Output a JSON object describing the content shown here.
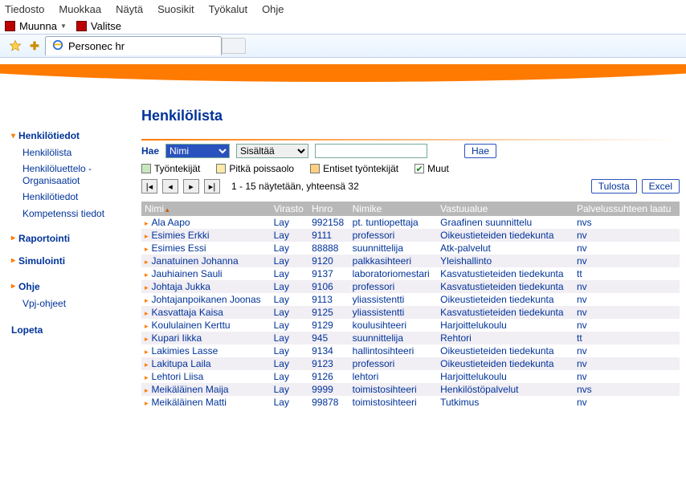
{
  "menubar": [
    "Tiedosto",
    "Muokkaa",
    "Näytä",
    "Suosikit",
    "Työkalut",
    "Ohje"
  ],
  "toolbar": {
    "convert": "Muunna",
    "select": "Valitse"
  },
  "tab_title": "Personec hr",
  "sidebar": {
    "sections": [
      {
        "label": "Henkilötiedot",
        "items": [
          "Henkilölista",
          "Henkilöluettelo - Organisaatiot",
          "Henkilötiedot",
          "Kompetenssi tiedot"
        ]
      },
      {
        "label": "Raportointi",
        "items": []
      },
      {
        "label": "Simulointi",
        "items": []
      },
      {
        "label": "Ohje",
        "items": [
          "Vpj-ohjeet"
        ]
      },
      {
        "label": "Lopeta",
        "items": []
      }
    ]
  },
  "page_title": "Henkilölista",
  "filters": {
    "label": "Hae",
    "field": "Nimi",
    "mode": "Sisältää",
    "search_btn": "Hae"
  },
  "checks": [
    {
      "label": "Työntekijät",
      "class": "c-green",
      "checked": false
    },
    {
      "label": "Pitkä poissaolo",
      "class": "c-yellow",
      "checked": false
    },
    {
      "label": "Entiset työntekijät",
      "class": "c-orange",
      "checked": false
    },
    {
      "label": "Muut",
      "class": "",
      "checked": true
    }
  ],
  "pager": {
    "status": "1 - 15 näytetään, yhteensä 32",
    "print": "Tulosta",
    "excel": "Excel"
  },
  "columns": [
    "Nimi",
    "Virasto",
    "Hnro",
    "Nimike",
    "Vastuualue",
    "Palvelussuhteen laatu"
  ],
  "rows": [
    {
      "name": "Ala Aapo",
      "virasto": "Lay",
      "hnro": "992158",
      "nimike": "pt. tuntiopettaja",
      "vastuu": "Graafinen suunnittelu",
      "laatu": "nvs"
    },
    {
      "name": "Esimies Erkki",
      "virasto": "Lay",
      "hnro": "9111",
      "nimike": "professori",
      "vastuu": "Oikeustieteiden tiedekunta",
      "laatu": "nv"
    },
    {
      "name": "Esimies Essi",
      "virasto": "Lay",
      "hnro": "88888",
      "nimike": "suunnittelija",
      "vastuu": "Atk-palvelut",
      "laatu": "nv"
    },
    {
      "name": "Janatuinen Johanna",
      "virasto": "Lay",
      "hnro": "9120",
      "nimike": "palkkasihteeri",
      "vastuu": "Yleishallinto",
      "laatu": "nv"
    },
    {
      "name": "Jauhiainen Sauli",
      "virasto": "Lay",
      "hnro": "9137",
      "nimike": "laboratoriomestari",
      "vastuu": "Kasvatustieteiden tiedekunta",
      "laatu": "tt"
    },
    {
      "name": "Johtaja Jukka",
      "virasto": "Lay",
      "hnro": "9106",
      "nimike": "professori",
      "vastuu": "Kasvatustieteiden tiedekunta",
      "laatu": "nv"
    },
    {
      "name": "Johtajanpoikanen Joonas",
      "virasto": "Lay",
      "hnro": "9113",
      "nimike": "yliassistentti",
      "vastuu": "Oikeustieteiden tiedekunta",
      "laatu": "nv"
    },
    {
      "name": "Kasvattaja Kaisa",
      "virasto": "Lay",
      "hnro": "9125",
      "nimike": "yliassistentti",
      "vastuu": "Kasvatustieteiden tiedekunta",
      "laatu": "nv"
    },
    {
      "name": "Koululainen Kerttu",
      "virasto": "Lay",
      "hnro": "9129",
      "nimike": "koulusihteeri",
      "vastuu": "Harjoittelukoulu",
      "laatu": "nv"
    },
    {
      "name": "Kupari Iikka",
      "virasto": "Lay",
      "hnro": "945",
      "nimike": "suunnittelija",
      "vastuu": "Rehtori",
      "laatu": "tt"
    },
    {
      "name": "Lakimies Lasse",
      "virasto": "Lay",
      "hnro": "9134",
      "nimike": "hallintosihteeri",
      "vastuu": "Oikeustieteiden tiedekunta",
      "laatu": "nv"
    },
    {
      "name": "Lakitupa Laila",
      "virasto": "Lay",
      "hnro": "9123",
      "nimike": "professori",
      "vastuu": "Oikeustieteiden tiedekunta",
      "laatu": "nv"
    },
    {
      "name": "Lehtori Liisa",
      "virasto": "Lay",
      "hnro": "9126",
      "nimike": "lehtori",
      "vastuu": "Harjoittelukoulu",
      "laatu": "nv"
    },
    {
      "name": "Meikäläinen Maija",
      "virasto": "Lay",
      "hnro": "9999",
      "nimike": "toimistosihteeri",
      "vastuu": "Henkilöstöpalvelut",
      "laatu": "nvs"
    },
    {
      "name": "Meikäläinen Matti",
      "virasto": "Lay",
      "hnro": "99878",
      "nimike": "toimistosihteeri",
      "vastuu": "Tutkimus",
      "laatu": "nv"
    }
  ]
}
